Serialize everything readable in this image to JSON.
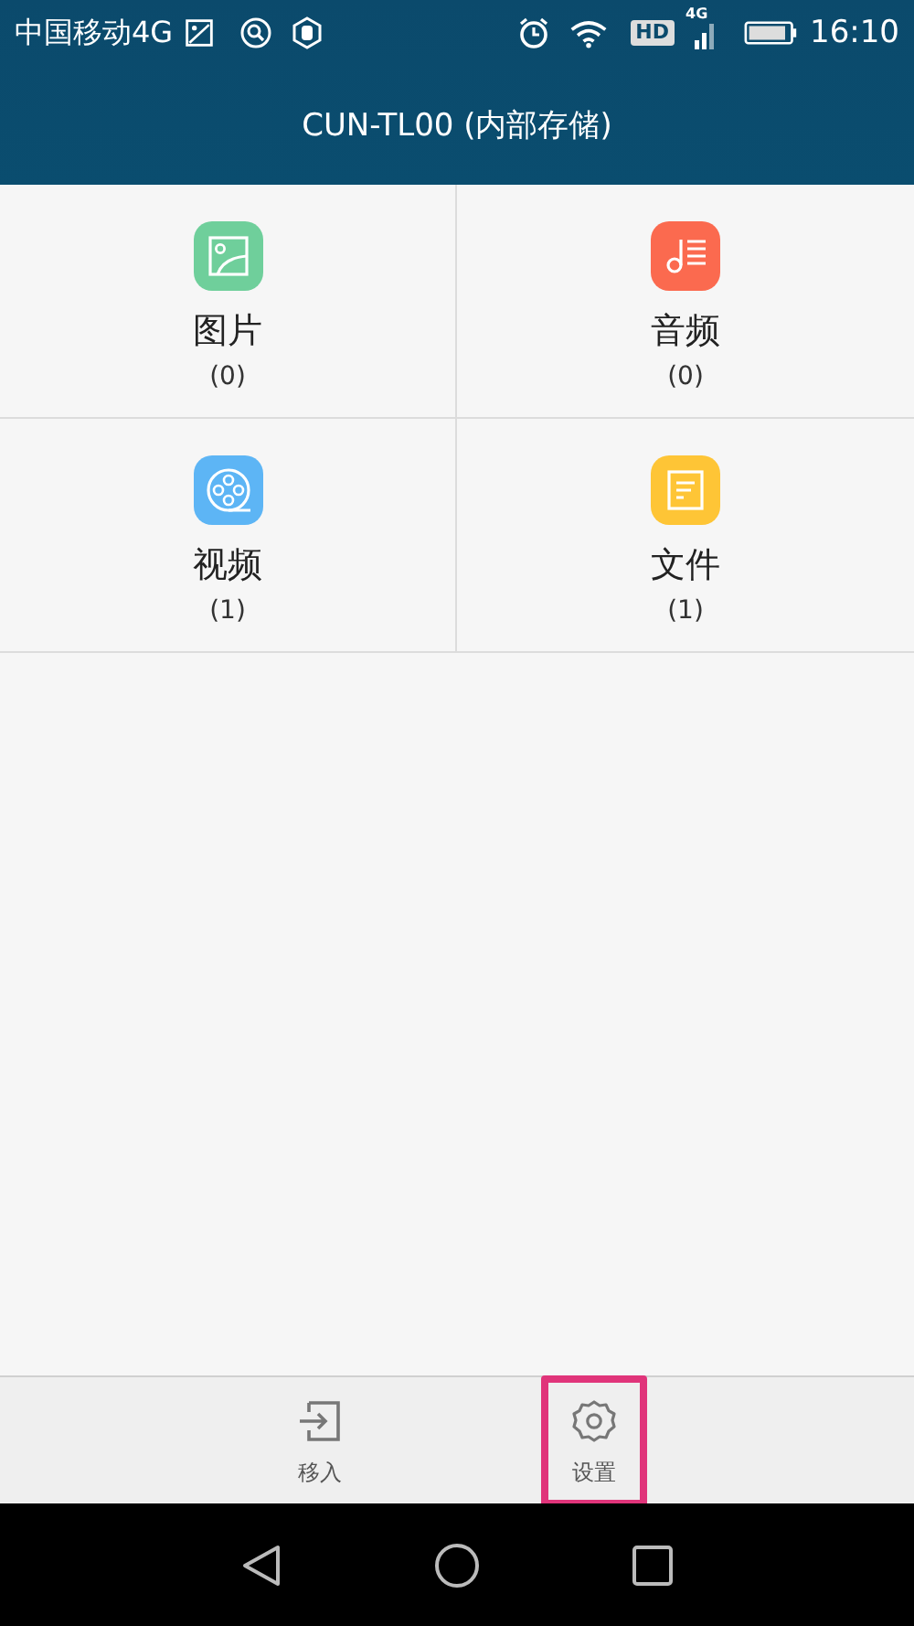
{
  "status_bar": {
    "carrier": "中国移动4G",
    "hd": "HD",
    "network_type": "4G",
    "time": "16:10"
  },
  "header": {
    "title": "CUN-TL00 (内部存储)"
  },
  "categories": [
    {
      "kind": "picture",
      "label": "图片",
      "count": "(0)",
      "color": "#6fcf9b"
    },
    {
      "kind": "music",
      "label": "音频",
      "count": "(0)",
      "color": "#fb6a4f"
    },
    {
      "kind": "video",
      "label": "视频",
      "count": "(1)",
      "color": "#5db5f5"
    },
    {
      "kind": "document",
      "label": "文件",
      "count": "(1)",
      "color": "#fec536"
    }
  ],
  "toolbar": [
    {
      "kind": "move-in",
      "label": "移入",
      "highlighted": false
    },
    {
      "kind": "settings",
      "label": "设置",
      "highlighted": true
    }
  ]
}
